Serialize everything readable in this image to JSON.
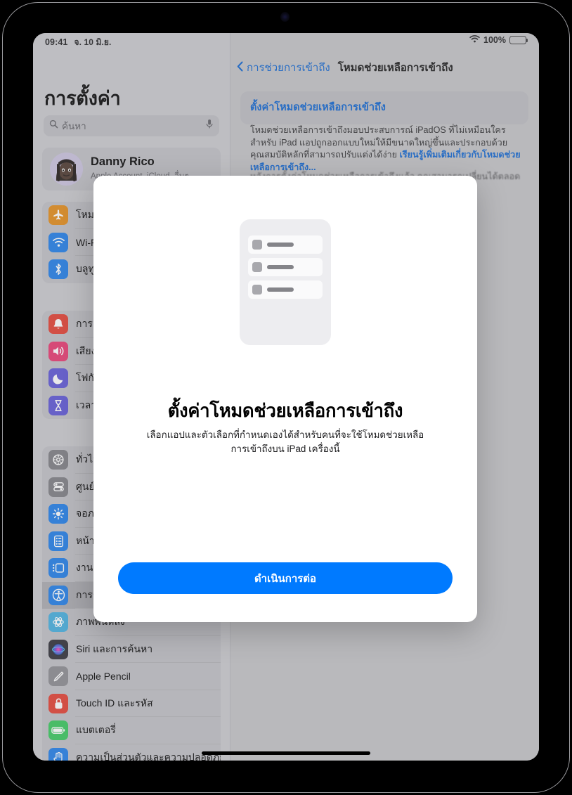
{
  "status_bar": {
    "time": "09:41",
    "date": "จ. 10 มิ.ย.",
    "wifi_icon": "wifi-icon",
    "battery_percent": "100%",
    "battery_icon": "battery-full-icon"
  },
  "sidebar": {
    "title": "การตั้งค่า",
    "search": {
      "placeholder": "ค้นหา",
      "icon": "search-icon",
      "mic_icon": "microphone-icon"
    },
    "account": {
      "name": "Danny Rico",
      "subtitle": "Apple Account, iCloud, อื่นๆ",
      "avatar": "memoji-avatar"
    },
    "groups": [
      {
        "items": [
          {
            "label": "โหมดเครื่องบิน",
            "icon": "airplane-icon",
            "color": "#e38a14",
            "selected": false
          },
          {
            "label": "Wi-Fi",
            "icon": "wifi-icon",
            "color": "#1b7ce8",
            "selected": false
          },
          {
            "label": "บลูทูธ",
            "icon": "bluetooth-icon",
            "color": "#1b7ce8",
            "selected": false
          }
        ]
      },
      {
        "items": [
          {
            "label": "การแจ้งเตือน",
            "icon": "bell-icon",
            "color": "#e33b2e",
            "selected": false
          },
          {
            "label": "เสียง",
            "icon": "speaker-icon",
            "color": "#e8356d",
            "selected": false
          },
          {
            "label": "โฟกัส",
            "icon": "moon-icon",
            "color": "#5a52d5",
            "selected": false
          },
          {
            "label": "เวลาหน้าจอ",
            "icon": "hourglass-icon",
            "color": "#5a52d5",
            "selected": false
          }
        ]
      },
      {
        "items": [
          {
            "label": "ทั่วไป",
            "icon": "gear-icon",
            "color": "#7c7c80",
            "selected": false
          },
          {
            "label": "ศูนย์ควบคุม",
            "icon": "control-center-icon",
            "color": "#7c7c80",
            "selected": false
          },
          {
            "label": "จอภาพและความสว่าง",
            "icon": "brightness-icon",
            "color": "#1b7ce8",
            "selected": false
          },
          {
            "label": "หน้าจอโฮมและไลบรารีแอป",
            "icon": "home-screen-icon",
            "color": "#1b7ce8",
            "selected": false
          },
          {
            "label": "งานหลายอย่างและท่าทาง",
            "icon": "multitasking-icon",
            "color": "#1b7ce8",
            "selected": false
          },
          {
            "label": "การช่วยการเข้าถึง",
            "icon": "accessibility-icon",
            "color": "#1b7ce8",
            "selected": true
          },
          {
            "label": "ภาพพื้นหลัง",
            "icon": "wallpaper-icon",
            "color": "#42aede",
            "selected": false
          },
          {
            "label": "Siri และการค้นหา",
            "icon": "siri-icon",
            "color": "#2b2b33",
            "selected": false
          },
          {
            "label": "Apple Pencil",
            "icon": "pencil-icon",
            "color": "#8a8a8f",
            "selected": false
          },
          {
            "label": "Touch ID และรหัส",
            "icon": "lock-icon",
            "color": "#e33b2e",
            "selected": false
          },
          {
            "label": "แบตเตอรี่",
            "icon": "battery-icon",
            "color": "#34c759",
            "selected": false
          },
          {
            "label": "ความเป็นส่วนตัวและความปลอดภัย",
            "icon": "hand-privacy-icon",
            "color": "#1b7ce8",
            "selected": false
          }
        ]
      }
    ]
  },
  "detail": {
    "back_label": "การช่วยการเข้าถึง",
    "back_icon": "chevron-left-icon",
    "title": "โหมดช่วยเหลือการเข้าถึง",
    "card_title": "ตั้งค่าโหมดช่วยเหลือการเข้าถึง",
    "body_part_1": "โหมดช่วยเหลือการเข้าถึงมอบประสบการณ์ iPadOS ที่ไม่เหมือนใครสำหรับ iPad แอปถูกออกแบบใหม่ให้มีขนาดใหญ่ขึ้นและประกอบด้วยคุณสมบัติหลักที่สามารถปรับแต่งได้ง่าย ",
    "body_link": "เรียนรู้เพิ่มเติมเกี่ยวกับโหมดช่วยเหลือการเข้าถึง...",
    "body_part_2": "หลังการตั้งค่าโหมดช่วยเหลือการเข้าถึงแล้ว คุณสามารถเปลี่ยนได้ตลอดเวลาใน"
  },
  "modal": {
    "illustration": "app-list-illustration",
    "illustration_rows": 3,
    "title": "ตั้งค่าโหมดช่วยเหลือการเข้าถึง",
    "subtitle": "เลือกแอปและตัวเลือกที่กำหนดเองได้สำหรับคนที่จะใช้โหมดช่วยเหลือการเข้าถึงบน iPad เครื่องนี้",
    "continue_label": "ดำเนินการต่อ"
  },
  "colors": {
    "accent_blue": "#007aff",
    "link_blue": "#0a62d0",
    "sidebar_bg": "#cacace",
    "detail_bg": "#c3c3c6",
    "modal_bg": "#ffffff"
  }
}
